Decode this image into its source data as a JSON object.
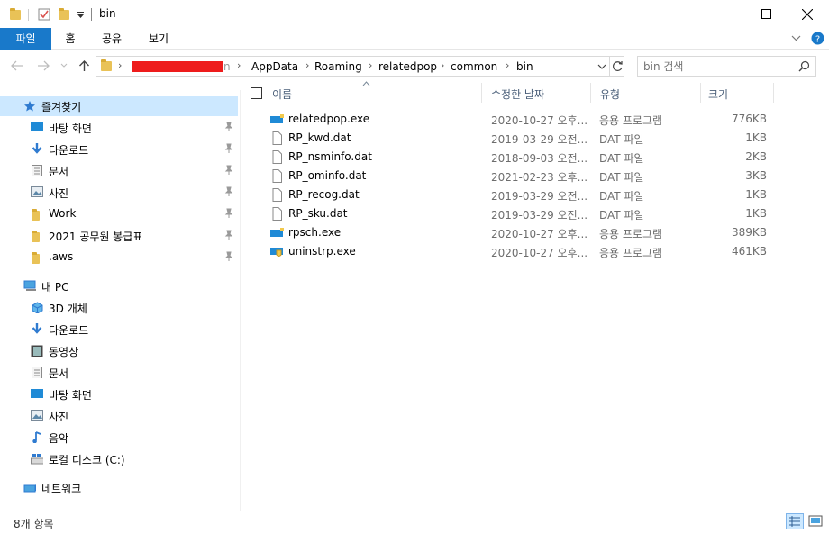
{
  "window": {
    "title": "bin",
    "controls": [
      "minimize-icon",
      "maximize-icon",
      "close-icon"
    ]
  },
  "ribbon": {
    "tabs": [
      {
        "label": "파일",
        "active": true
      },
      {
        "label": "홈",
        "active": false
      },
      {
        "label": "공유",
        "active": false
      },
      {
        "label": "보기",
        "active": false
      }
    ]
  },
  "address": {
    "path": [
      "AppData",
      "Roaming",
      "relatedpop",
      "common",
      "bin"
    ],
    "redacted_prefix_tail": "n"
  },
  "search": {
    "placeholder": "bin 검색"
  },
  "navpane": {
    "quick_access": {
      "label": "즐겨찾기",
      "items": [
        {
          "label": "바탕 화면",
          "icon": "desktop-icon",
          "pinned": true
        },
        {
          "label": "다운로드",
          "icon": "download-icon",
          "pinned": true
        },
        {
          "label": "문서",
          "icon": "document-icon",
          "pinned": true
        },
        {
          "label": "사진",
          "icon": "pictures-icon",
          "pinned": true
        },
        {
          "label": "Work",
          "icon": "folder-icon",
          "pinned": true
        },
        {
          "label": "2021 공무원 봉급표",
          "icon": "folder-icon",
          "pinned": true
        },
        {
          "label": ".aws",
          "icon": "folder-icon",
          "pinned": true
        }
      ]
    },
    "this_pc": {
      "label": "내 PC",
      "items": [
        {
          "label": "3D 개체",
          "icon": "3d-objects-icon"
        },
        {
          "label": "다운로드",
          "icon": "download-icon"
        },
        {
          "label": "동영상",
          "icon": "video-icon"
        },
        {
          "label": "문서",
          "icon": "document-icon"
        },
        {
          "label": "바탕 화면",
          "icon": "desktop-icon"
        },
        {
          "label": "사진",
          "icon": "pictures-icon"
        },
        {
          "label": "음악",
          "icon": "music-icon"
        },
        {
          "label": "로컬 디스크 (C:)",
          "icon": "drive-icon"
        }
      ]
    },
    "network": {
      "label": "네트워크"
    }
  },
  "filelist": {
    "columns": [
      "이름",
      "수정한 날짜",
      "유형",
      "크기"
    ],
    "files": [
      {
        "name": "relatedpop.exe",
        "date": "2020-10-27 오후...",
        "type": "응용 프로그램",
        "size": "776KB",
        "icon": "exe-icon"
      },
      {
        "name": "RP_kwd.dat",
        "date": "2019-03-29 오전...",
        "type": "DAT 파일",
        "size": "1KB",
        "icon": "file-icon"
      },
      {
        "name": "RP_nsminfo.dat",
        "date": "2018-09-03 오전...",
        "type": "DAT 파일",
        "size": "2KB",
        "icon": "file-icon"
      },
      {
        "name": "RP_ominfo.dat",
        "date": "2021-02-23 오후...",
        "type": "DAT 파일",
        "size": "3KB",
        "icon": "file-icon"
      },
      {
        "name": "RP_recog.dat",
        "date": "2019-03-29 오전...",
        "type": "DAT 파일",
        "size": "1KB",
        "icon": "file-icon"
      },
      {
        "name": "RP_sku.dat",
        "date": "2019-03-29 오전...",
        "type": "DAT 파일",
        "size": "1KB",
        "icon": "file-icon"
      },
      {
        "name": "rpsch.exe",
        "date": "2020-10-27 오후...",
        "type": "응용 프로그램",
        "size": "389KB",
        "icon": "exe-icon"
      },
      {
        "name": "uninstrp.exe",
        "date": "2020-10-27 오후...",
        "type": "응용 프로그램",
        "size": "461KB",
        "icon": "installer-icon"
      }
    ]
  },
  "status": {
    "item_count": "8개 항목"
  },
  "colors": {
    "accent": "#1979ca",
    "selected_nav": "#cce8ff",
    "folder": "#e9c257"
  }
}
